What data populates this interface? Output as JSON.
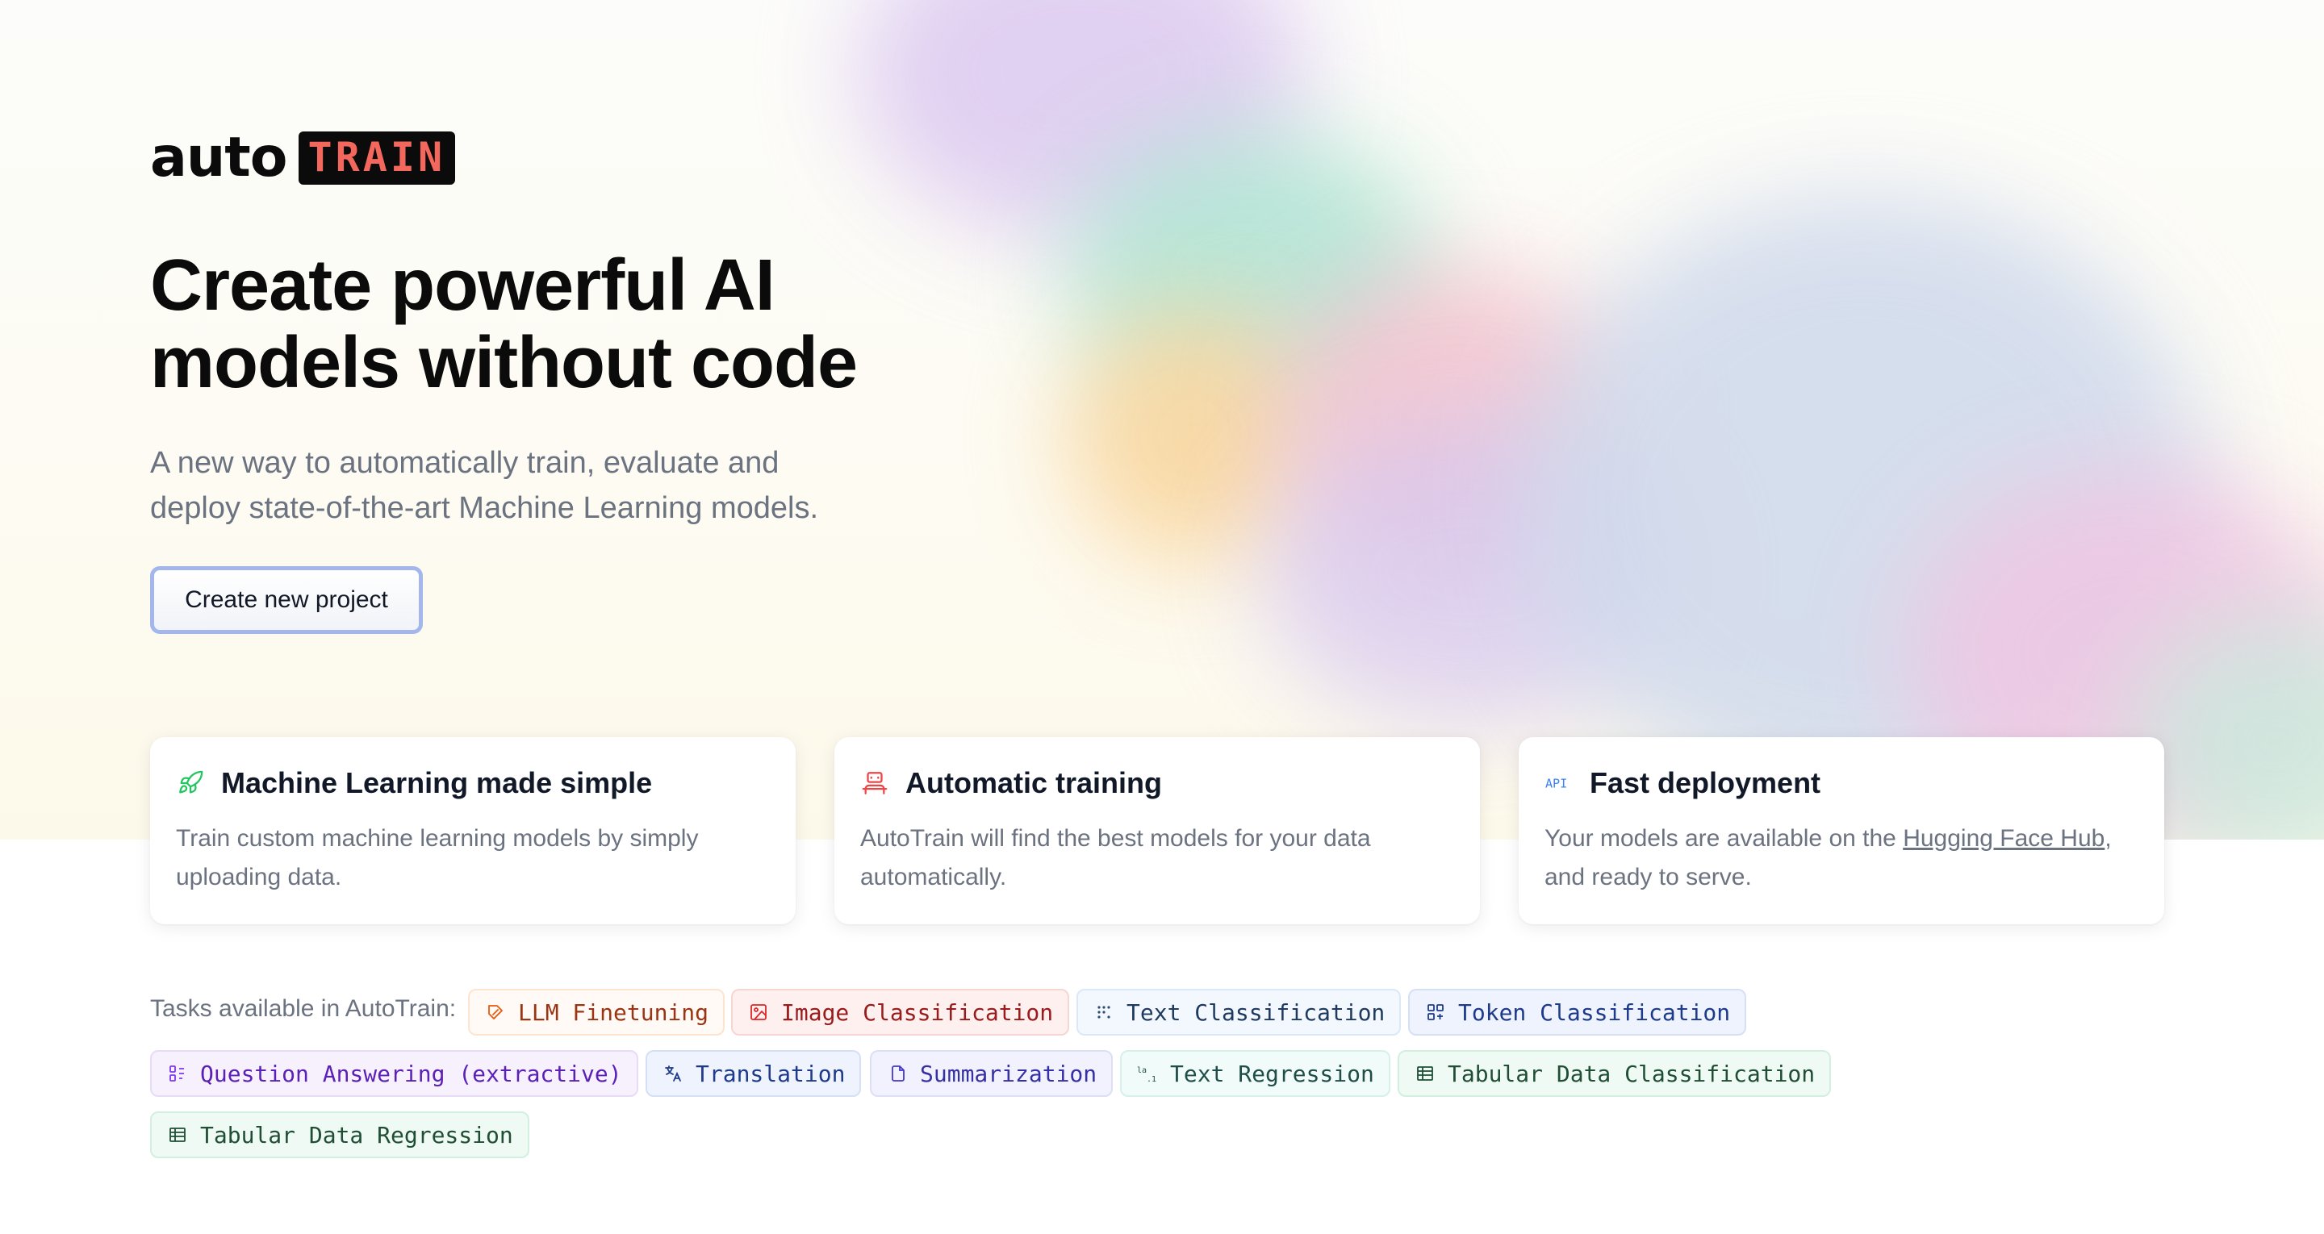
{
  "logo": {
    "auto": "auto",
    "train": "TRAIN"
  },
  "hero": {
    "headline_line1": "Create powerful AI",
    "headline_line2": "models without code",
    "subtitle_line1": "A new way to automatically train, evaluate and",
    "subtitle_line2": "deploy state-of-the-art Machine Learning models.",
    "cta_label": "Create new project"
  },
  "features": [
    {
      "icon": "rocket-icon",
      "title": "Machine Learning made simple",
      "desc": "Train custom machine learning models by simply uploading data.",
      "icon_color": "#22c55e"
    },
    {
      "icon": "robot-icon",
      "title": "Automatic training",
      "desc": "AutoTrain will find the best models for your data automatically.",
      "icon_color": "#ef4444"
    },
    {
      "icon": "api-icon",
      "title": "Fast deployment",
      "desc_before": "Your models are available on the ",
      "desc_link": "Hugging Face Hub",
      "desc_after": ",",
      "desc_line2": "and ready to serve.",
      "icon_label": "API",
      "icon_color": "#3b82f6"
    }
  ],
  "tasks": {
    "label": "Tasks available in AutoTrain:",
    "items": [
      {
        "label": "LLM Finetuning",
        "icon": "edit-tag-icon"
      },
      {
        "label": "Image Classification",
        "icon": "image-icon"
      },
      {
        "label": "Text Classification",
        "icon": "dots-icon"
      },
      {
        "label": "Token Classification",
        "icon": "token-icon"
      },
      {
        "label": "Question Answering (extractive)",
        "icon": "qa-icon"
      },
      {
        "label": "Translation",
        "icon": "translate-icon"
      },
      {
        "label": "Summarization",
        "icon": "document-icon"
      },
      {
        "label": "Text Regression",
        "icon": "regression-icon"
      },
      {
        "label": "Tabular Data Classification",
        "icon": "table-icon"
      },
      {
        "label": "Tabular Data Regression",
        "icon": "table-icon"
      }
    ]
  }
}
